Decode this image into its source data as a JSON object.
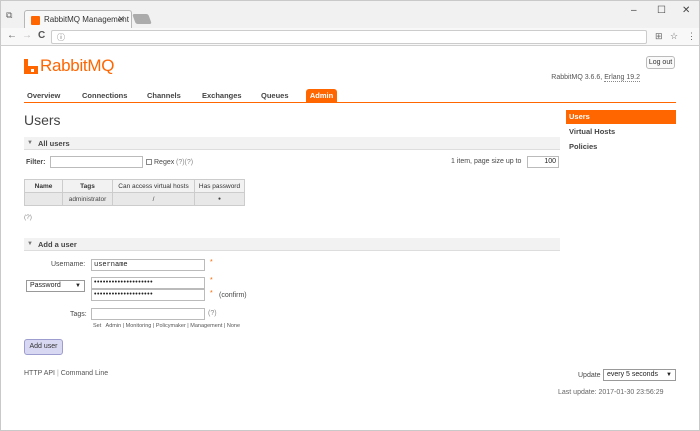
{
  "browser": {
    "tab_title": "RabbitMQ Management",
    "win_icon": "⧉",
    "close_tab": "✕",
    "minimize": "–",
    "maximize": "☐",
    "close": "✕",
    "back": "←",
    "forward": "→",
    "reload": "C",
    "info": "ⓘ",
    "translate": "⊞",
    "star": "☆",
    "menu": "⋮"
  },
  "header": {
    "brand": "RabbitMQ",
    "logout_label": "Log out",
    "version_prefix": "RabbitMQ 3.6.6, ",
    "erlang": "Erlang 19.2"
  },
  "nav": {
    "tabs": [
      "Overview",
      "Connections",
      "Channels",
      "Exchanges",
      "Queues"
    ],
    "active": "Admin"
  },
  "page": {
    "title": "Users"
  },
  "all_users": {
    "section_label": "All users",
    "filter_label": "Filter:",
    "regex_label": "Regex",
    "regex_help": "(?)(?)",
    "paging_text": "1 item, page size up to",
    "page_size": "100",
    "columns": [
      "Name",
      "Tags",
      "Can access virtual hosts",
      "Has password"
    ],
    "rows": [
      {
        "name": "",
        "tags": "administrator",
        "vhosts": "/",
        "has_password": "●"
      }
    ],
    "help": "(?)"
  },
  "add_user": {
    "section_label": "Add a user",
    "username_label": "Username:",
    "username_value": "username",
    "required": "*",
    "password_select": "Password",
    "password_value": "••••••••••••••••••••",
    "confirm_value": "••••••••••••••••••••",
    "confirm_label": "(confirm)",
    "tags_label": "Tags:",
    "tags_help": "(?)",
    "set_prefix": "Set",
    "tag_options": [
      "Admin",
      "Monitoring",
      "Policymaker",
      "Management",
      "None"
    ],
    "submit_label": "Add user"
  },
  "footer": {
    "http_api": "HTTP API",
    "command_line": "Command Line",
    "update_label": "Update",
    "update_value": "every 5 seconds",
    "last_update": "Last update: 2017-01-30 23:56:29"
  },
  "sidebar": {
    "items": [
      "Users",
      "Virtual Hosts",
      "Policies"
    ]
  },
  "colors": {
    "accent": "#ff6600",
    "button_bg": "#d8d8f2"
  }
}
